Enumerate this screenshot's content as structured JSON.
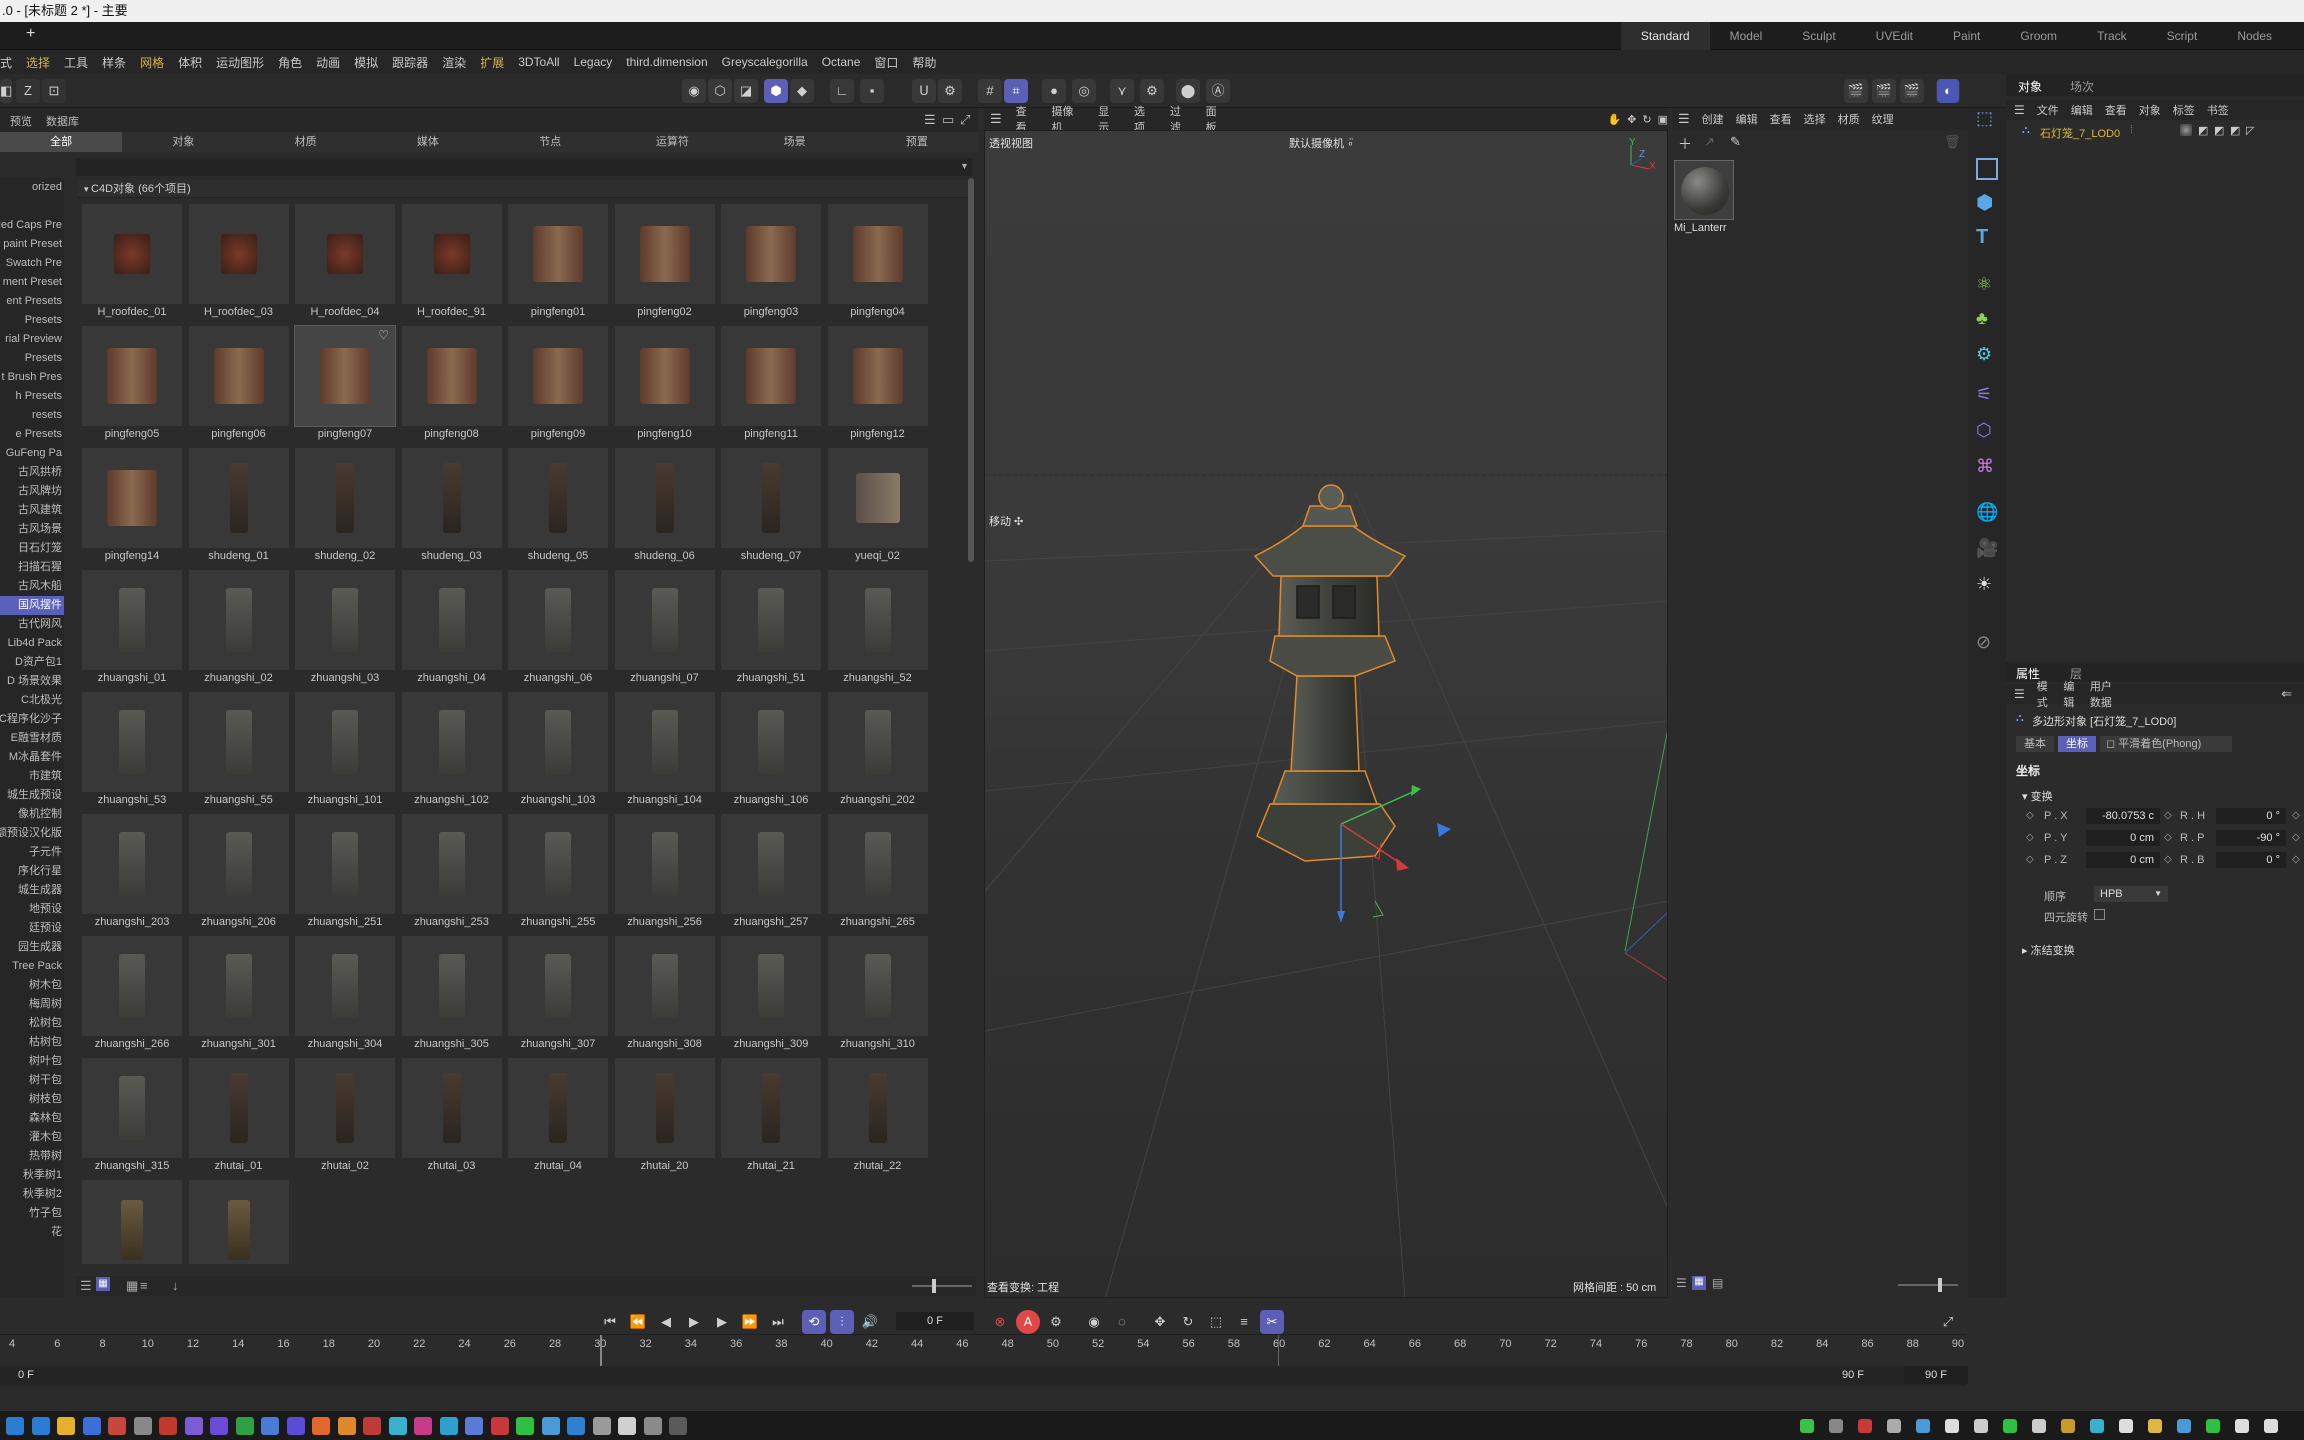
{
  "window": {
    "title": ".0 - [未标题 2 *] - 主要"
  },
  "layouts": [
    "Standard",
    "Model",
    "Sculpt",
    "UVEdit",
    "Paint",
    "Groom",
    "Track",
    "Script",
    "Nodes"
  ],
  "menu": [
    "式",
    "选择",
    "工具",
    "样条",
    "网格",
    "体积",
    "运动图形",
    "角色",
    "动画",
    "模拟",
    "跟踪器",
    "渲染",
    "扩展",
    "3DToAll",
    "Legacy",
    "third.dimension",
    "Greyscalegorilla",
    "Octane",
    "窗口",
    "帮助"
  ],
  "browser": {
    "sub_menu": [
      "预览",
      "数据库"
    ],
    "category_tabs": [
      "全部",
      "对象",
      "材质",
      "媒体",
      "节点",
      "运算符",
      "场景",
      "预置"
    ],
    "group_header": "C4D对象 (66个项目)",
    "tree": [
      "orized",
      "",
      "led Caps Pre",
      "paint Preset",
      "Swatch Pre",
      "ment Preset",
      "ent Presets",
      "Presets",
      "rial Preview",
      "Presets",
      "t Brush Pres",
      "h Presets",
      "resets",
      "e Presets",
      "GuFeng Pa",
      "古风拱桥",
      "古风牌坊",
      "古风建筑",
      "古风场景",
      "日石灯笼",
      "扫描石猩",
      "古风木船",
      "国风摆件",
      "古代网风",
      "Lib4d Pack",
      "D资产包1",
      "D 场景效果",
      "C北极光",
      "C程序化沙子",
      "E融雪材质",
      "M冰晶套件",
      "市建筑",
      "城生成预设",
      "像机控制",
      "额预设汉化版",
      "子元件",
      "序化行星",
      "城生成器",
      "地预设",
      "廷预设",
      "园生成器",
      "Tree Pack",
      "树木包",
      "梅周树",
      "松树包",
      "枯树包",
      "树叶包",
      "树干包",
      "树枝包",
      "森林包",
      "灌木包",
      "热带树",
      "秋季树1",
      "秋季树2",
      "竹子包",
      "花"
    ],
    "items": [
      "H_roofdec_01",
      "H_roofdec_03",
      "H_roofdec_04",
      "H_roofdec_91",
      "pingfeng01",
      "pingfeng02",
      "pingfeng03",
      "pingfeng04",
      "pingfeng05",
      "pingfeng06",
      "pingfeng07",
      "pingfeng08",
      "pingfeng09",
      "pingfeng10",
      "pingfeng11",
      "pingfeng12",
      "pingfeng14",
      "shudeng_01",
      "shudeng_02",
      "shudeng_03",
      "shudeng_05",
      "shudeng_06",
      "shudeng_07",
      "yueqi_02",
      "zhuangshi_01",
      "zhuangshi_02",
      "zhuangshi_03",
      "zhuangshi_04",
      "zhuangshi_06",
      "zhuangshi_07",
      "zhuangshi_51",
      "zhuangshi_52",
      "zhuangshi_53",
      "zhuangshi_55",
      "zhuangshi_101",
      "zhuangshi_102",
      "zhuangshi_103",
      "zhuangshi_104",
      "zhuangshi_106",
      "zhuangshi_202",
      "zhuangshi_203",
      "zhuangshi_206",
      "zhuangshi_251",
      "zhuangshi_253",
      "zhuangshi_255",
      "zhuangshi_256",
      "zhuangshi_257",
      "zhuangshi_265",
      "zhuangshi_266",
      "zhuangshi_301",
      "zhuangshi_304",
      "zhuangshi_305",
      "zhuangshi_307",
      "zhuangshi_308",
      "zhuangshi_309",
      "zhuangshi_310",
      "zhuangshi_315",
      "zhutai_01",
      "zhutai_02",
      "zhutai_03",
      "zhutai_04",
      "zhutai_20",
      "zhutai_21",
      "zhutai_22",
      "",
      ""
    ]
  },
  "viewport": {
    "menu": [
      "查看",
      "摄像机",
      "显示",
      "选项",
      "过滤",
      "面板"
    ],
    "label": "透视视图",
    "camera": "默认摄像机 ∘̈",
    "move_label": "移动 ✣",
    "bottom_left": "查看变换: 工程",
    "bottom_right": "网格间距 : 50 cm",
    "axis_y": "Y",
    "axis_x": "X",
    "axis_z": "Z"
  },
  "materials": {
    "menu": [
      "创建",
      "编辑",
      "查看",
      "选择",
      "材质",
      "纹理"
    ],
    "material_name": "Mi_Lanterr"
  },
  "objects": {
    "tabs": [
      "对象",
      "场次"
    ],
    "menu": [
      "文件",
      "编辑",
      "查看",
      "对象",
      "标签",
      "书签"
    ],
    "item": "石灯笼_7_LOD0"
  },
  "attributes": {
    "tabs": [
      "属性",
      "层"
    ],
    "menu": [
      "模式",
      "编辑",
      "用户数据"
    ],
    "object": "多边形对象 [石灯笼_7_LOD0]",
    "sub_tabs": [
      "基本",
      "坐标",
      "平滑着色(Phong)"
    ],
    "section": "坐标",
    "group_transform": "变换",
    "rows": [
      {
        "label": "P . X",
        "value": "-80.0753 c",
        "rlabel": "R . H",
        "rvalue": "0 °"
      },
      {
        "label": "P . Y",
        "value": "0 cm",
        "rlabel": "R . P",
        "rvalue": "-90 °"
      },
      {
        "label": "P . Z",
        "value": "0 cm",
        "rlabel": "R . B",
        "rvalue": "0 °"
      }
    ],
    "order_label": "顺序",
    "order_value": "HPB",
    "quat_label": "四元旋转",
    "freeze_label": "冻结变换"
  },
  "timeline": {
    "current_frame": "0 F",
    "ticks": [
      "4",
      "6",
      "8",
      "10",
      "12",
      "14",
      "16",
      "18",
      "20",
      "22",
      "24",
      "26",
      "28",
      "30",
      "32",
      "34",
      "36",
      "38",
      "40",
      "42",
      "44",
      "46",
      "48",
      "50",
      "52",
      "54",
      "56",
      "58",
      "60",
      "62",
      "64",
      "66",
      "68",
      "70",
      "72",
      "74",
      "76",
      "78",
      "80",
      "82",
      "84",
      "86",
      "88",
      "90"
    ],
    "range_start": "0 F",
    "range_end": "90 F",
    "range_end2": "90 F"
  },
  "colors": {
    "accent": "#5b5fb6",
    "selection_outline": "#e58a2a",
    "menu_highlight": "#d7b34a"
  }
}
